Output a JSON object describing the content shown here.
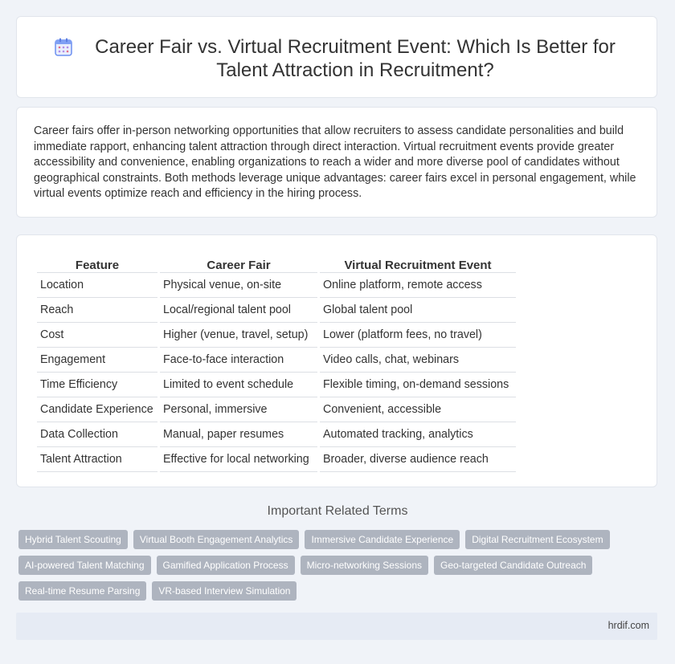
{
  "header": {
    "title": "Career Fair vs. Virtual Recruitment Event: Which Is Better for Talent Attraction in Recruitment?",
    "icon": "calendar-icon"
  },
  "intro": {
    "text": "Career fairs offer in-person networking opportunities that allow recruiters to assess candidate personalities and build immediate rapport, enhancing talent attraction through direct interaction. Virtual recruitment events provide greater accessibility and convenience, enabling organizations to reach a wider and more diverse pool of candidates without geographical constraints. Both methods leverage unique advantages: career fairs excel in personal engagement, while virtual events optimize reach and efficiency in the hiring process."
  },
  "table": {
    "headers": [
      "Feature",
      "Career Fair",
      "Virtual Recruitment Event"
    ],
    "rows": [
      [
        "Location",
        "Physical venue, on-site",
        "Online platform, remote access"
      ],
      [
        "Reach",
        "Local/regional talent pool",
        "Global talent pool"
      ],
      [
        "Cost",
        "Higher (venue, travel, setup)",
        "Lower (platform fees, no travel)"
      ],
      [
        "Engagement",
        "Face-to-face interaction",
        "Video calls, chat, webinars"
      ],
      [
        "Time Efficiency",
        "Limited to event schedule",
        "Flexible timing, on-demand sessions"
      ],
      [
        "Candidate Experience",
        "Personal, immersive",
        "Convenient, accessible"
      ],
      [
        "Data Collection",
        "Manual, paper resumes",
        "Automated tracking, analytics"
      ],
      [
        "Talent Attraction",
        "Effective for local networking",
        "Broader, diverse audience reach"
      ]
    ]
  },
  "related": {
    "title": "Important Related Terms",
    "tags": [
      "Hybrid Talent Scouting",
      "Virtual Booth Engagement Analytics",
      "Immersive Candidate Experience",
      "Digital Recruitment Ecosystem",
      "AI-powered Talent Matching",
      "Gamified Application Process",
      "Micro-networking Sessions",
      "Geo-targeted Candidate Outreach",
      "Real-time Resume Parsing",
      "VR-based Interview Simulation"
    ]
  },
  "footer": {
    "site": "hrdif.com"
  },
  "colors": {
    "background": "#f0f3f8",
    "tag": "#aeb4bf",
    "footer": "#e6ebf4",
    "icon": "#5b8def"
  }
}
